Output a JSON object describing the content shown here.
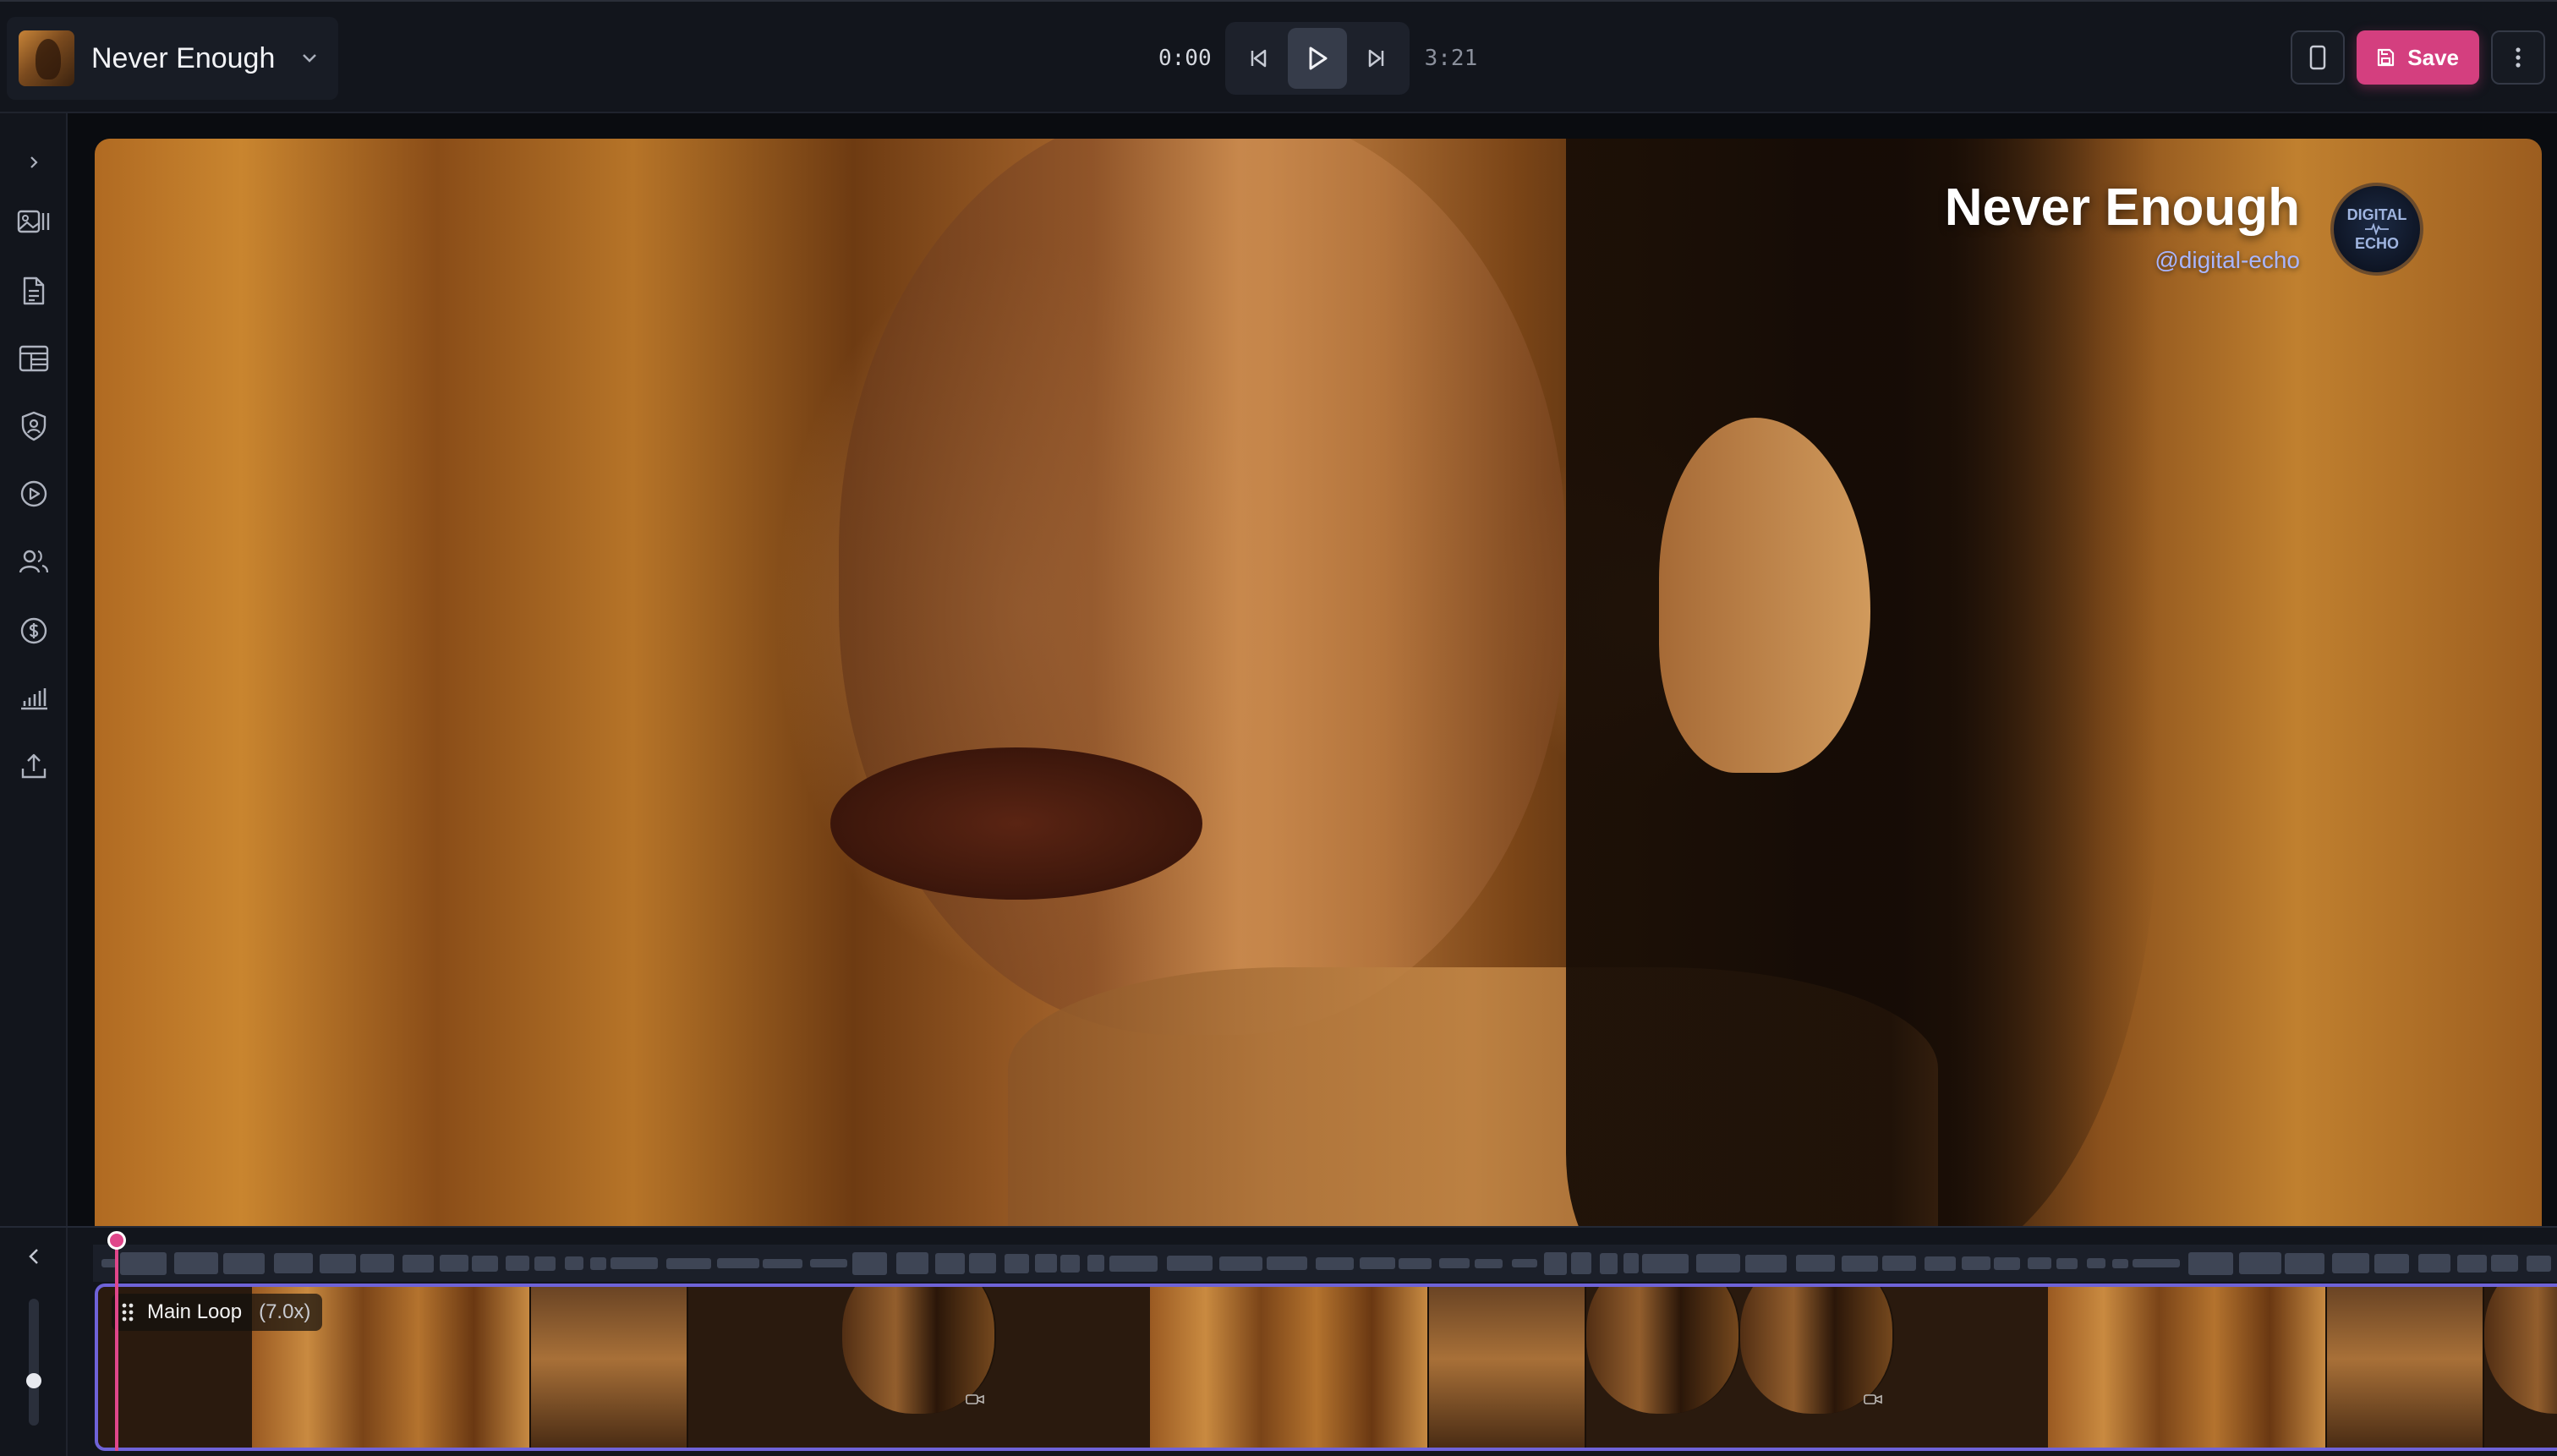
{
  "project": {
    "title": "Never Enough"
  },
  "transport": {
    "current_time": "0:00",
    "total_time": "3:21"
  },
  "actions": {
    "save_label": "Save"
  },
  "rail": {
    "items": [
      {
        "icon": "chevron-right-icon",
        "name": "expand-sidebar"
      },
      {
        "icon": "image-gallery-icon",
        "name": "media"
      },
      {
        "icon": "document-icon",
        "name": "lyrics"
      },
      {
        "icon": "table-icon",
        "name": "layout"
      },
      {
        "icon": "shield-user-icon",
        "name": "rights"
      },
      {
        "icon": "play-circle-icon",
        "name": "playback"
      },
      {
        "icon": "users-icon",
        "name": "collaborators"
      },
      {
        "icon": "dollar-circle-icon",
        "name": "monetization"
      },
      {
        "icon": "bar-chart-icon",
        "name": "analytics"
      },
      {
        "icon": "upload-icon",
        "name": "export"
      }
    ]
  },
  "preview": {
    "overlay_title": "Never Enough",
    "overlay_handle": "@digital-echo",
    "logo_line1": "DIGITAL",
    "logo_line2": "ECHO"
  },
  "timeline": {
    "clip_name": "Main Loop",
    "clip_speed": "(7.0x)",
    "frames": [
      "face",
      "curtain",
      "room",
      "face",
      "face",
      "face",
      "curtain",
      "room",
      "face",
      "face",
      "face",
      "curtain",
      "room",
      "face"
    ]
  },
  "colors": {
    "accent": "#d43f7f",
    "clip_border": "#6f63d8",
    "handle": "#a9b6ff"
  }
}
